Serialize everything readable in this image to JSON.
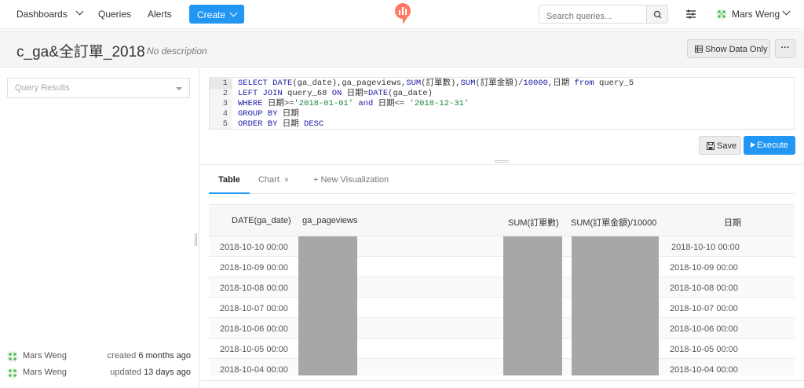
{
  "nav": {
    "dashboards": "Dashboards",
    "queries": "Queries",
    "alerts": "Alerts",
    "create": "Create",
    "search_placeholder": "Search queries...",
    "user_name": "Mars Weng"
  },
  "query": {
    "title": "c_ga&全訂單_2018",
    "description": "No description",
    "show_data_only": "Show Data Only",
    "more": "···"
  },
  "sidebar": {
    "results_placeholder": "Query Results",
    "meta": [
      {
        "user": "Mars Weng",
        "action": "created",
        "when": "6 months ago"
      },
      {
        "user": "Mars Weng",
        "action": "updated",
        "when": "13 days ago"
      }
    ]
  },
  "editor": {
    "line_numbers": [
      "1",
      "2",
      "3",
      "4",
      "5"
    ],
    "lines": [
      {
        "parts": [
          "SELECT",
          " ",
          "DATE",
          "(ga_date),ga_pageviews,",
          "SUM",
          "(訂單數),",
          "SUM",
          "(訂單金額)/",
          "10000",
          ",日期 ",
          "from",
          " query_5"
        ]
      },
      {
        "parts": [
          "LEFT JOIN",
          " query_68 ",
          "ON",
          " 日期=",
          "DATE",
          "(ga_date)"
        ]
      },
      {
        "parts": [
          "WHERE",
          " 日期>=",
          "'2018-01-01'",
          " ",
          "and",
          " 日期<= ",
          "'2018-12-31'"
        ]
      },
      {
        "parts": [
          "GROUP BY",
          " 日期"
        ]
      },
      {
        "parts": [
          "ORDER BY",
          " 日期 ",
          "DESC"
        ]
      }
    ],
    "save": "Save",
    "execute": "Execute"
  },
  "tabs": [
    "Table",
    "Chart",
    "×",
    "+ New Visualization"
  ],
  "table": {
    "columns": [
      "DATE(ga_date)",
      "ga_pageviews",
      "SUM(訂單數)",
      "SUM(訂單金額)/10000",
      "日期"
    ],
    "rows": [
      [
        "2018-10-10 00:00",
        "2018-10-10 00:00"
      ],
      [
        "2018-10-09 00:00",
        "2018-10-09 00:00"
      ],
      [
        "2018-10-08 00:00",
        "2018-10-08 00:00"
      ],
      [
        "2018-10-07 00:00",
        "2018-10-07 00:00"
      ],
      [
        "2018-10-06 00:00",
        "2018-10-06 00:00"
      ],
      [
        "2018-10-05 00:00",
        "2018-10-05 00:00"
      ],
      [
        "2018-10-04 00:00",
        "2018-10-04 00:00"
      ]
    ]
  },
  "colors": {
    "primary": "#2196f3",
    "logo": "#ff7964",
    "redacted": "#a7a7a7"
  }
}
